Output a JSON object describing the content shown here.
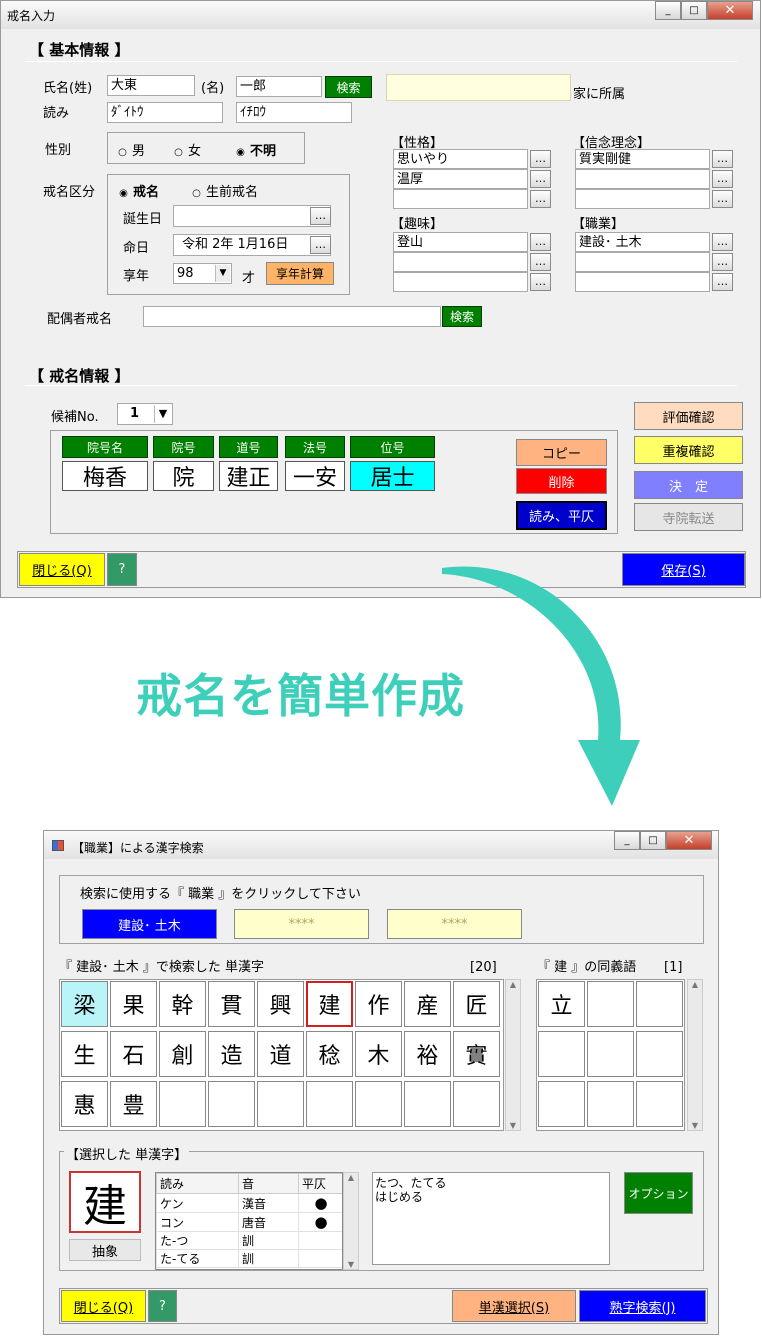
{
  "win1": {
    "title": "戒名入力",
    "sec_basic": "【 基本情報 】",
    "name_sei_label": "氏名(姓)",
    "name_sei": "大東",
    "name_mei_label": "(名)",
    "name_mei": "一郎",
    "search_btn": "検索",
    "family_suffix": "家に所属",
    "yomi_label": "読み",
    "yomi_sei": "ﾀﾞｲﾄｳ",
    "yomi_mei": "ｲﾁﾛｳ",
    "gender_label": "性別",
    "gender_male": "男",
    "gender_female": "女",
    "gender_unknown": "不明",
    "kaimyo_kubun_label": "戒名区分",
    "kubun_kaimyo": "戒名",
    "kubun_seizen": "生前戒名",
    "birth_label": "誕生日",
    "birth_value": "",
    "death_label": "命日",
    "death_value": "令和 2年 1月16日",
    "age_label": "享年",
    "age_value": "98",
    "age_unit": "才",
    "age_calc_btn": "享年計算",
    "seikaku_label": "【性格】",
    "seikaku": [
      "思いやり",
      "温厚",
      ""
    ],
    "shinnen_label": "【信念理念】",
    "shinnen": [
      "質実剛健",
      "",
      ""
    ],
    "shumi_label": "【趣味】",
    "shumi": [
      "登山",
      "",
      ""
    ],
    "shokugyo_label": "【職業】",
    "shokugyo": [
      "建設･ 土木",
      "",
      ""
    ],
    "dots": "…",
    "spouse_label": "配偶者戒名",
    "spouse_value": "",
    "spouse_search": "検索",
    "sec_kaimyo": "【 戒名情報 】",
    "candidate_label": "候補No.",
    "candidate_value": "1",
    "headers": [
      "院号名",
      "院号",
      "道号",
      "法号",
      "位号"
    ],
    "kaimyo": [
      "梅香",
      "院",
      "建正",
      "一安",
      "居士"
    ],
    "copy_btn": "コピー",
    "delete_btn": "削除",
    "yomi_btn": "読み、平仄",
    "eval_btn": "評価確認",
    "dup_btn": "重複確認",
    "decide_btn": "決　定",
    "transfer_btn": "寺院転送",
    "close_btn": "閉じる(Q)",
    "help_btn": "?",
    "save_btn": "保存(S)",
    "min": "_",
    "max": "□",
    "close_x": "✕"
  },
  "banner": {
    "text": "戒名を簡単作成",
    "color": "#3dcfba"
  },
  "win2": {
    "title": "【職業】による漢字検索",
    "instruction": "検索に使用する『 職業 』をクリックして下さい",
    "job_btns": [
      "建設･ 土木",
      "****",
      "****"
    ],
    "result_label": "『 建設･ 土木 』で検索した 単漢字",
    "result_count": "[20]",
    "chars": [
      "梁",
      "果",
      "幹",
      "貫",
      "興",
      "建",
      "作",
      "産",
      "匠",
      "生",
      "石",
      "創",
      "造",
      "道",
      "稔",
      "木",
      "裕",
      "實",
      "惠",
      "豊"
    ],
    "syn_label": "『 建 』の同義語",
    "syn_count": "[1]",
    "syn_chars": [
      "立"
    ],
    "selected_label": "【選択した 単漢字】",
    "selected_char": "建",
    "abstract_btn": "抽象",
    "table_headers": [
      "読み",
      "音",
      "平仄"
    ],
    "table_rows": [
      [
        "ケン",
        "漢音",
        "●"
      ],
      [
        "コン",
        "唐音",
        "●"
      ],
      [
        "た-つ",
        "訓",
        ""
      ],
      [
        "た-てる",
        "訓",
        ""
      ]
    ],
    "reading_text": [
      "たつ、たてる",
      "はじめる"
    ],
    "option_btn": "オプション",
    "close_btn": "閉じる(Q)",
    "help_btn": "?",
    "single_btn": "単漢選択(S)",
    "jukugo_btn": "熟字検索(J)",
    "min": "_",
    "max": "□",
    "close_x": "✕"
  }
}
